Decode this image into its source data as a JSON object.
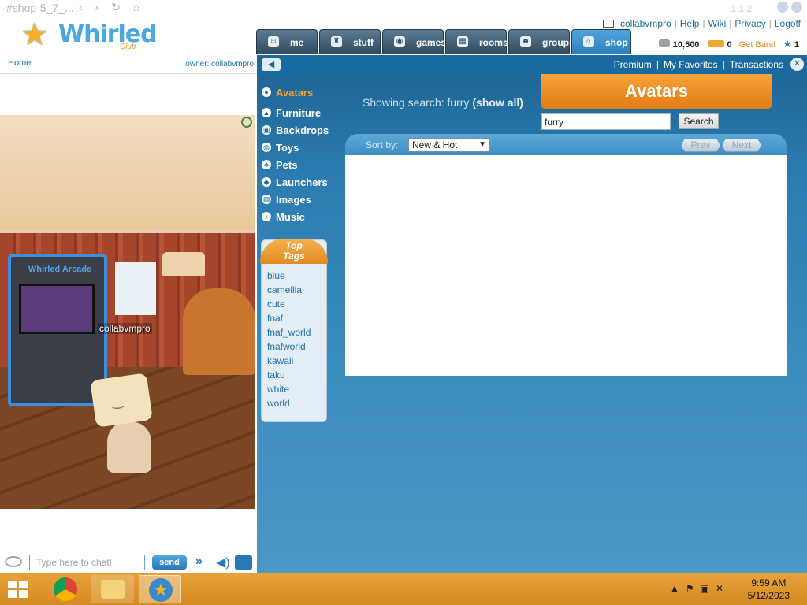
{
  "browser": {
    "title": "#shop-5_7_...",
    "page_indicator": "1 1 2"
  },
  "logo": {
    "word": "Whirled",
    "club": "Club"
  },
  "header_links": {
    "user": "collabvmpro",
    "help": "Help",
    "wiki": "Wiki",
    "privacy": "Privacy",
    "logoff": "Logoff",
    "coins": "10,500",
    "bars": "0",
    "get_bars": "Get Bars!",
    "stars": "1"
  },
  "tabs": [
    {
      "label": "me",
      "icon": "face-icon"
    },
    {
      "label": "stuff",
      "icon": "chair-icon"
    },
    {
      "label": "games",
      "icon": "invader-icon"
    },
    {
      "label": "rooms",
      "icon": "room-icon"
    },
    {
      "label": "groups",
      "icon": "people-icon"
    },
    {
      "label": "shop",
      "icon": "shop-icon"
    }
  ],
  "subnav": {
    "premium": "Premium",
    "favorites": "My Favorites",
    "transactions": "Transactions"
  },
  "room": {
    "home": "Home",
    "owner": "owner: collabvmpro",
    "player_name": "collabvmpro",
    "arcade_marquee": "Whirled Arcade"
  },
  "categories": [
    {
      "label": "Avatars",
      "active": true
    },
    {
      "label": "Furniture",
      "active": false
    },
    {
      "label": "Backdrops",
      "active": false
    },
    {
      "label": "Toys",
      "active": false
    },
    {
      "label": "Pets",
      "active": false
    },
    {
      "label": "Launchers",
      "active": false
    },
    {
      "label": "Images",
      "active": false
    },
    {
      "label": "Music",
      "active": false
    }
  ],
  "top_tags": {
    "header_line1": "Top",
    "header_line2": "Tags",
    "tags": [
      "blue",
      "camellia",
      "cute",
      "fnaf",
      "fnaf_world",
      "fnafworld",
      "kawaii",
      "taku",
      "white",
      "world"
    ]
  },
  "search": {
    "showing": "Showing search: furry",
    "show_all": "(show all)",
    "banner": "Avatars",
    "query": "furry",
    "button": "Search"
  },
  "results": {
    "sort_label": "Sort by:",
    "sort_value": "New & Hot",
    "prev": "Prev",
    "next": "Next"
  },
  "chat": {
    "placeholder": "Type here to chat!",
    "send": "send"
  },
  "taskbar": {
    "time": "9:59 AM",
    "date": "5/12/2023"
  }
}
